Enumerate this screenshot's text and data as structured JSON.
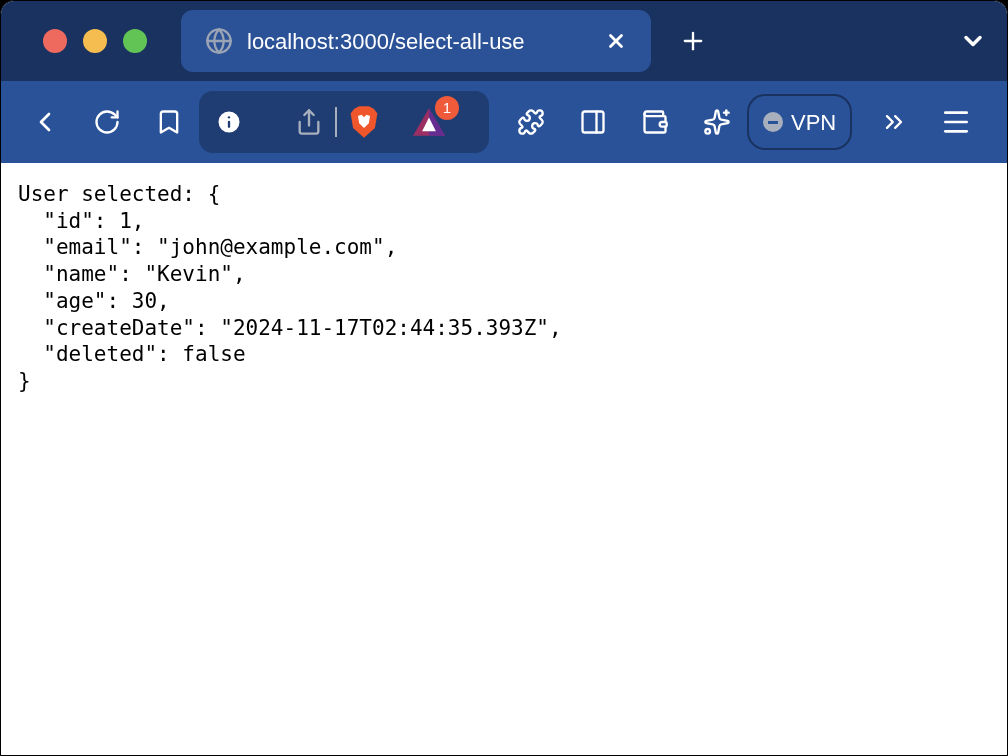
{
  "tabs": [
    {
      "title": "localhost:3000/select-all-use",
      "selected": true
    }
  ],
  "toolbar": {
    "rewards_badge": "1",
    "vpn": {
      "label": "VPN",
      "on": false
    }
  },
  "page": {
    "lines": [
      "User selected: {",
      "  \"id\": 1,",
      "  \"email\": \"john@example.com\",",
      "  \"name\": \"Kevin\",",
      "  \"age\": 30,",
      "  \"createDate\": \"2024-11-17T02:44:35.393Z\",",
      "  \"deleted\": false",
      "}"
    ]
  }
}
